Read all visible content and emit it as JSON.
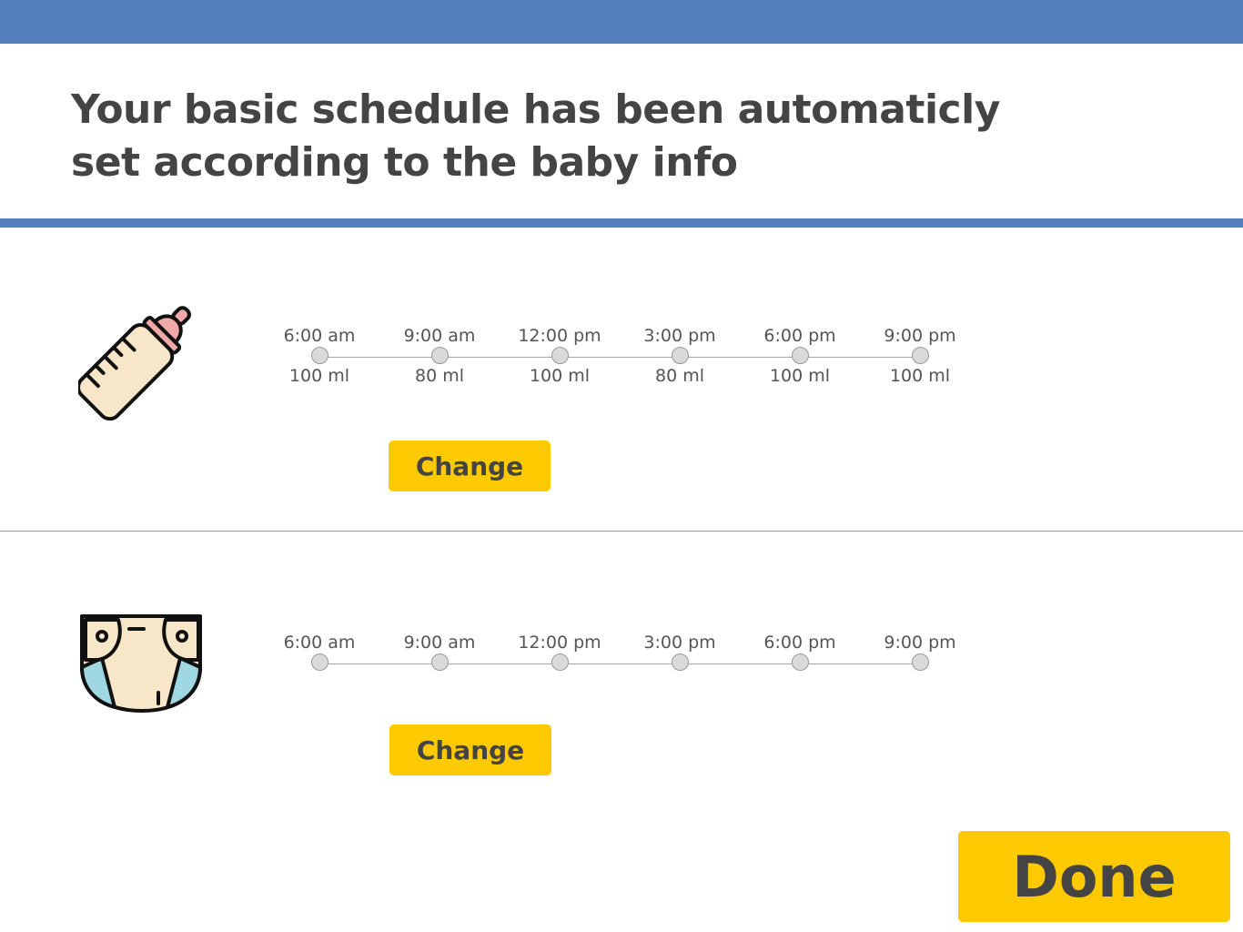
{
  "header": {
    "title_line1": "Your basic schedule has been automaticly",
    "title_line2": "set according to the baby info"
  },
  "feeding": {
    "icon": "baby-bottle-icon",
    "points": [
      {
        "time": "6:00 am",
        "amount": "100 ml"
      },
      {
        "time": "9:00 am",
        "amount": "80 ml"
      },
      {
        "time": "12:00 pm",
        "amount": "100 ml"
      },
      {
        "time": "3:00 pm",
        "amount": "80 ml"
      },
      {
        "time": "6:00 pm",
        "amount": "100 ml"
      },
      {
        "time": "9:00 pm",
        "amount": "100 ml"
      }
    ],
    "change_label": "Change"
  },
  "diaper": {
    "icon": "diaper-icon",
    "points": [
      {
        "time": "6:00 am"
      },
      {
        "time": "9:00 am"
      },
      {
        "time": "12:00 pm"
      },
      {
        "time": "3:00 pm"
      },
      {
        "time": "6:00 pm"
      },
      {
        "time": "9:00 pm"
      }
    ],
    "change_label": "Change"
  },
  "footer": {
    "done_label": "Done"
  },
  "colors": {
    "accent_blue": "#5380bd",
    "button_yellow": "#fdc900",
    "text": "#444444"
  }
}
